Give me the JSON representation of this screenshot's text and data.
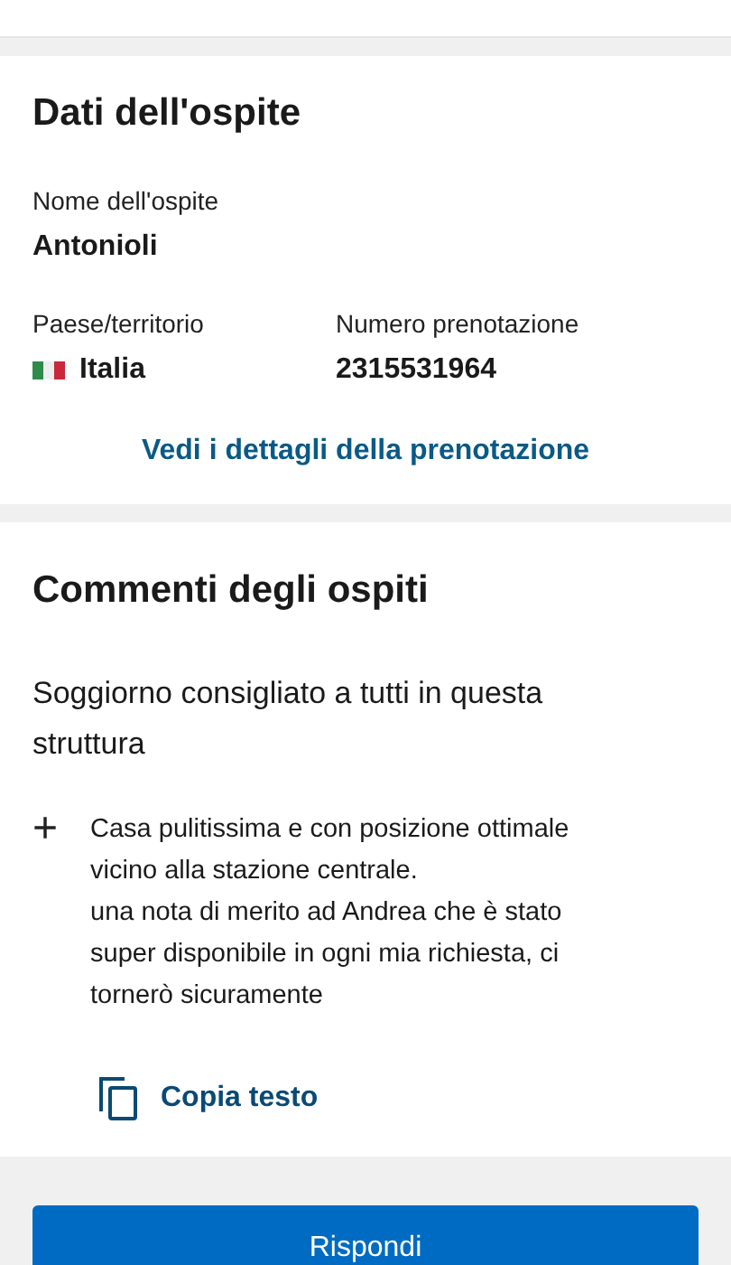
{
  "guest_section": {
    "title": "Dati dell'ospite",
    "name_label": "Nome dell'ospite",
    "name_value": "Antonioli",
    "country_label": "Paese/territorio",
    "country_value": "Italia",
    "booking_label": "Numero prenotazione",
    "booking_value": "2315531964",
    "details_link": "Vedi i dettagli della prenotazione"
  },
  "comments_section": {
    "title": "Commenti degli ospiti",
    "headline": "Soggiorno consigliato a tutti in questa struttura",
    "expand_icon": "+",
    "comment": "Casa pulitissima e con posizione ottimale vicino alla stazione centrale.\nuna nota di merito ad Andrea che è stato super disponibile in ogni mia richiesta, ci tornerò sicuramente",
    "copy_button": "Copia testo"
  },
  "reply_button": "Rispondi"
}
